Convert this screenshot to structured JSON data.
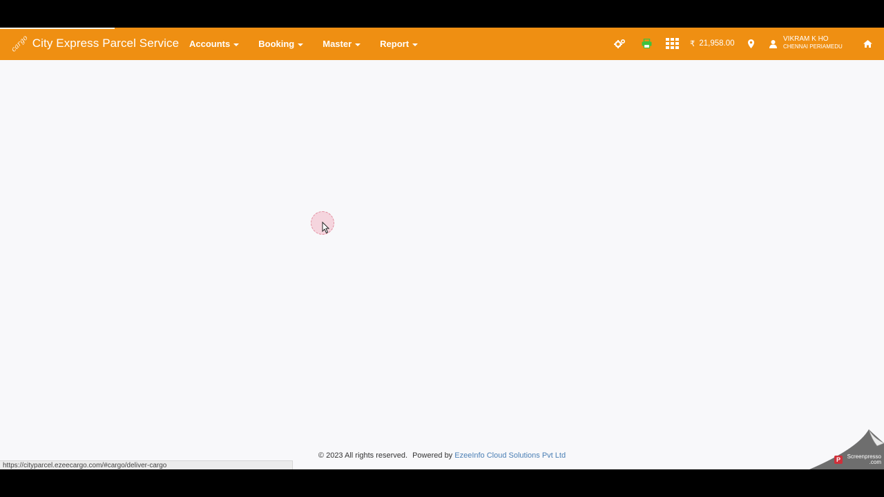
{
  "brand": {
    "mark": "cargo",
    "name": "City Express Parcel Service"
  },
  "menu": [
    {
      "label": "Accounts"
    },
    {
      "label": "Booking"
    },
    {
      "label": "Master"
    },
    {
      "label": "Report"
    }
  ],
  "toolbar": {
    "icons": [
      "settings-cogs-icon",
      "print-icon",
      "apps-grid-icon",
      "location-pin-icon",
      "home-icon"
    ],
    "currency_symbol": "₹",
    "balance": "21,958.00"
  },
  "user": {
    "name": "VIKRAM K HO",
    "location": "CHENNAI PERIAMEDU"
  },
  "footer": {
    "copyright": "© 2023 All rights reserved.",
    "powered_by": "Powered by",
    "company": "EzeeInfo Cloud Solutions Pvt Ltd"
  },
  "status_url": "https://cityparcel.ezeecargo.com/#cargo/deliver-cargo",
  "watermark": {
    "logo_letter": "P",
    "text_line1": "Screenpresso",
    "text_line2": ".com"
  },
  "colors": {
    "navbar": "#ef8f12",
    "print_icon": "#3ec23e",
    "footer_link": "#4a7fb5",
    "page_bg": "#f8f8fa"
  }
}
